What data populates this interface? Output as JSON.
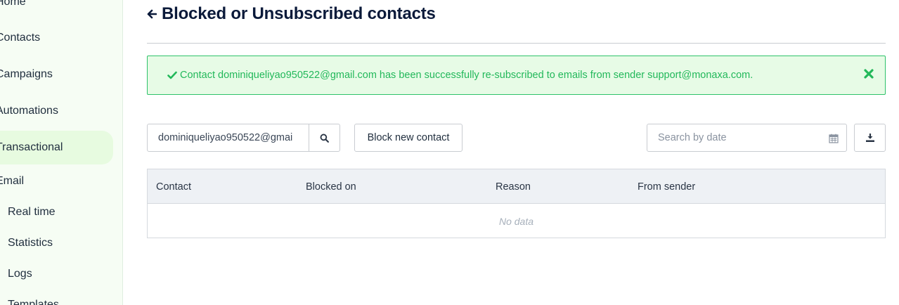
{
  "sidebar": {
    "items": [
      {
        "label": "Home"
      },
      {
        "label": "Contacts"
      },
      {
        "label": "Campaigns"
      },
      {
        "label": "Automations"
      },
      {
        "label": "Transactional"
      },
      {
        "label": "Email"
      },
      {
        "label": "Real time"
      },
      {
        "label": "Statistics"
      },
      {
        "label": "Logs"
      },
      {
        "label": "Templates"
      }
    ],
    "active": "Transactional"
  },
  "header": {
    "title": "Blocked or Unsubscribed contacts",
    "back_icon": "arrow-left-icon"
  },
  "alert": {
    "message": "Contact dominiqueliyao950522@gmail.com has been successfully re-subscribed to emails from sender support@monaxa.com.",
    "status_color": "#22b85a",
    "check_icon": "check-icon",
    "close_icon": "close-icon"
  },
  "toolbar": {
    "search_value": "dominiqueliyao950522@gmai",
    "search_icon": "search-icon",
    "block_button_label": "Block new contact",
    "date_placeholder": "Search by date",
    "calendar_icon": "calendar-icon",
    "download_icon": "download-icon"
  },
  "table": {
    "columns": [
      "Contact",
      "Blocked on",
      "Reason",
      "From sender"
    ],
    "rows": [],
    "empty_text": "No data"
  },
  "colors": {
    "accent": "#22b85a",
    "sidebar_bg": "#f6fdf4",
    "active_bg": "#e7fbe0",
    "title": "#0b1a3a"
  }
}
